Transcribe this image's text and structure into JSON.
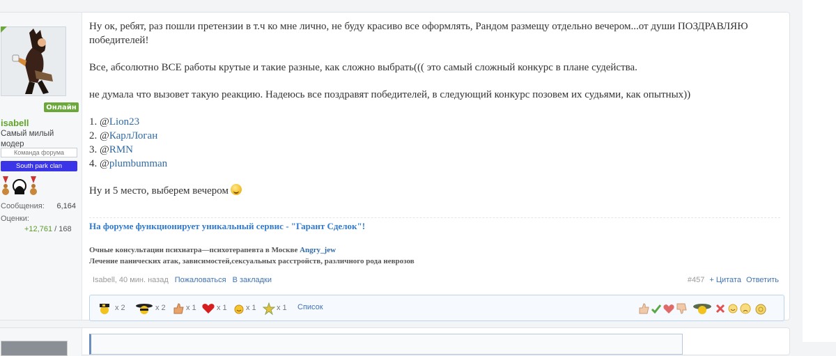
{
  "user": {
    "online_label": "Онлайн",
    "name": "isabell",
    "title": "Самый милый модер",
    "team_badge": "Команда форума",
    "clan_badge": "South park clan",
    "stats": [
      {
        "label": "Сообщения:",
        "value": "6,164"
      },
      {
        "label": "Оценки:",
        "value_positive": "+12,761",
        "value_rest": " / 168"
      }
    ]
  },
  "post": {
    "paragraphs": [
      "Ну ок, ребят, раз пошли претензии в т.ч ко мне лично, не буду красиво все оформлять, Рандом размещу отдельно вечером...от души ПОЗДРАВЛЯЮ победителей!",
      "Все, абсолютно ВСЕ работы крутые и такие разные, как сложно выбрать((( это самый сложный конкурс в плане судейства.",
      "не думала что вызовет такую реакцию. Надеюсь все поздравят победителей, в следующий конкурс позовем их судьями, как опытных))"
    ],
    "winners": [
      {
        "num": "1. @",
        "name": "Lion23"
      },
      {
        "num": "2. @",
        "name": "КарлЛоган"
      },
      {
        "num": "3. @",
        "name": "RMN"
      },
      {
        "num": "4. @",
        "name": "plumbumman"
      }
    ],
    "closing": "Ну и 5 место, выберем вечером"
  },
  "signature": {
    "link": "На форуме функционирует уникальный сервис - \"Гарант Сделок\"!",
    "line1": "Очные консультации психиатра—психотерапевта в Москве ",
    "line1_mention": "Angry_jew",
    "line2": "Лечение панических атак, зависимостей,сексуальных расстройств, различного рода неврозов"
  },
  "meta": {
    "author_time": "Isabell, 40 мин. назад",
    "report": "Пожаловаться",
    "bookmark": "В закладки",
    "post_number": "#457",
    "quote": "+ Цитата",
    "reply": "Ответить"
  },
  "reactions": {
    "given": [
      {
        "icon": "police-smiley-icon",
        "count": "x 2"
      },
      {
        "icon": "mafia-smiley-icon",
        "count": "x 2"
      },
      {
        "icon": "thumbs-up-icon",
        "count": "x 1"
      },
      {
        "icon": "heart-icon",
        "count": "x 1"
      },
      {
        "icon": "laugh-smiley-icon",
        "count": "x 1"
      },
      {
        "icon": "star-icon",
        "count": "x 1"
      }
    ],
    "list_label": "Список",
    "available_icons": [
      "like-icon",
      "check-icon",
      "heart-icon",
      "dislike-icon",
      "cap-smiley-icon",
      "cross-icon",
      "smile-icon",
      "sad-icon",
      "medal-icon"
    ]
  },
  "colors": {
    "username": "#63a32c",
    "link": "#2f6aa7",
    "online": "#6aa83a",
    "clan": "#3b35e8"
  }
}
